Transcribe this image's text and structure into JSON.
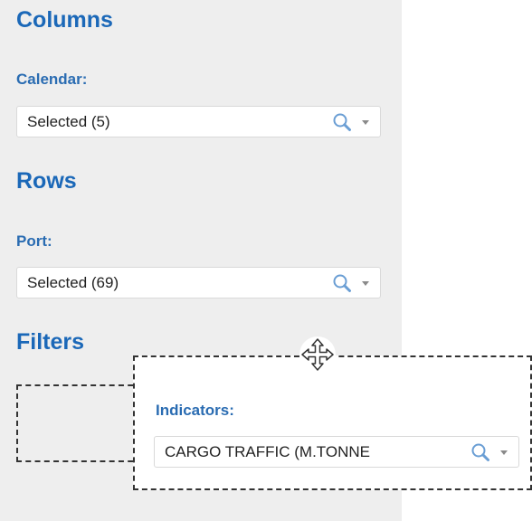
{
  "columns": {
    "title": "Columns",
    "field_label": "Calendar:",
    "value": "Selected (5)"
  },
  "rows": {
    "title": "Rows",
    "field_label": "Port:",
    "value": "Selected (69)"
  },
  "filters": {
    "title": "Filters"
  },
  "dragged_field": {
    "field_label": "Indicators:",
    "value": "CARGO TRAFFIC (M.TONNE"
  },
  "icons": {
    "search": "search-icon",
    "dropdown": "chevron-down-icon",
    "move": "move-icon"
  },
  "colors": {
    "heading": "#1b68b8",
    "label": "#2a6cb2",
    "panel_background": "#eeeeee"
  }
}
